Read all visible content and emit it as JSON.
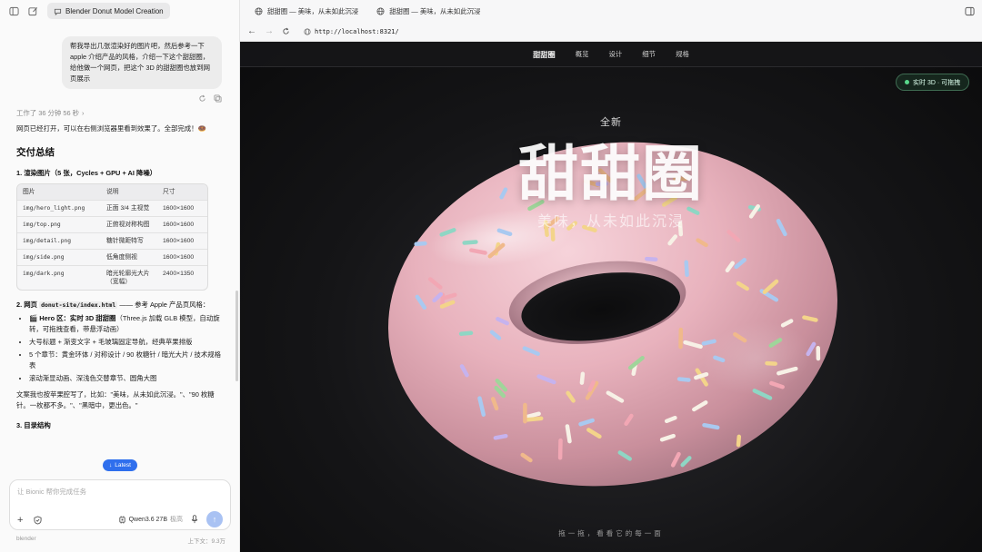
{
  "sidebar": {
    "chat_title": "Blender Donut Model Creation",
    "user_message": "帮我导出几张渲染好的图片吧，然后参考一下 apple 介绍产品的风格，介绍一下这个甜甜圈，给他做一个网页，把这个 3D 的甜甜圈也放到网页展示",
    "worked_time": "工作了 36 分钟 56 秒",
    "reply_intro": "网页已经打开，可以在右侧浏览器里看到效果了。全部完成！🍩",
    "summary_heading": "交付总结",
    "section1_title": "1. 渲染图片（5 张，Cycles + GPU + AI 降噪）",
    "table": {
      "headers": [
        "图片",
        "说明",
        "尺寸"
      ],
      "rows": [
        [
          "img/hero_light.png",
          "正面 3/4 主视觉",
          "1600×1600"
        ],
        [
          "img/top.png",
          "正俯视对称构图",
          "1600×1600"
        ],
        [
          "img/detail.png",
          "糖针微距特写",
          "1600×1600"
        ],
        [
          "img/side.png",
          "低角度侧视",
          "1600×1600"
        ],
        [
          "img/dark.png",
          "暗光轮廓光大片（宽幅）",
          "2400×1350"
        ]
      ]
    },
    "section2_prefix": "2. 网页",
    "section2_code": "donut-site/index.html",
    "section2_suffix": "—— 参考 Apple 产品页风格：",
    "bullets": [
      {
        "bold": "🎬 Hero 区：实时 3D 甜甜圈",
        "rest": "（Three.js 加载 GLB 模型，自动旋转，可拖拽查看，带悬浮动画）"
      },
      {
        "bold": "",
        "rest": "大号标题 + 渐变文字 + 毛玻璃固定导航，经典苹果排版"
      },
      {
        "bold": "",
        "rest": "5 个章节：黄金环体 / 对称设计 / 90 枚糖针 / 暗光大片 / 技术规格表"
      },
      {
        "bold": "",
        "rest": "滚动渐显动画、深浅色交替章节、圆角大图"
      }
    ],
    "copy_note": "文案我也按苹果腔写了，比如：\"美味，从未如此沉浸。\"、\"90 枚糖针。一枚都不多。\"、\"黑暗中，更出色。\"",
    "section3_title": "3. 目录结构",
    "latest_label": "Latest",
    "composer_placeholder": "让 Bionic 帮你完成任务",
    "model_name": "Qwen3.6 27B",
    "model_level": "极高",
    "footer_left": "blender",
    "footer_right": "上下文：9.3万"
  },
  "browser": {
    "tabs": [
      "甜甜圈 — 美味，从未如此沉浸",
      "甜甜圈 — 美味，从未如此沉浸"
    ],
    "url": "http://localhost:8321/"
  },
  "page": {
    "nav": {
      "brand": "甜甜圈",
      "links": [
        "概览",
        "设计",
        "细节",
        "规格"
      ]
    },
    "live_badge": "实时 3D · 可拖拽",
    "eyebrow": "全新",
    "title": "甜甜圈",
    "subtitle": "美味，从未如此沉浸",
    "hint": "拖一拖，看看它的每一面"
  },
  "colors": {
    "accent": "#2f6fed",
    "frosting": "#e9b3bf",
    "live_dot": "#59d98b"
  }
}
